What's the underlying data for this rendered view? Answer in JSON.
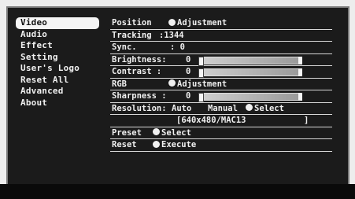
{
  "sidebar": {
    "items": [
      {
        "label": "Video",
        "selected": true
      },
      {
        "label": "Audio",
        "selected": false
      },
      {
        "label": "Effect",
        "selected": false
      },
      {
        "label": "Setting",
        "selected": false
      },
      {
        "label": "User's Logo",
        "selected": false
      },
      {
        "label": "Reset All",
        "selected": false
      },
      {
        "label": "Advanced",
        "selected": false
      },
      {
        "label": "About",
        "selected": false
      }
    ]
  },
  "main": {
    "position": {
      "label": "Position",
      "action": "Adjustment"
    },
    "tracking": {
      "label": "Tracking",
      "value": ":1344"
    },
    "sync": {
      "label": "Sync.",
      "value": ":  0"
    },
    "brightness": {
      "label": "Brightness:",
      "value": "0",
      "level": 0.5
    },
    "contrast": {
      "label": "Contrast  :",
      "value": "0",
      "level": 0.5
    },
    "rgb": {
      "label": "RGB",
      "action": "Adjustment"
    },
    "sharpness": {
      "label": "Sharpness :",
      "value": "0",
      "level": 0.5
    },
    "resolution": {
      "label": "Resolution:",
      "auto": "Auto",
      "manual": "Manual",
      "action": "Select",
      "mode": "[640x480/MAC13",
      "mode_end": "]"
    },
    "preset": {
      "label": "Preset",
      "action": "Select"
    },
    "reset": {
      "label": "Reset",
      "action": "Execute"
    }
  }
}
